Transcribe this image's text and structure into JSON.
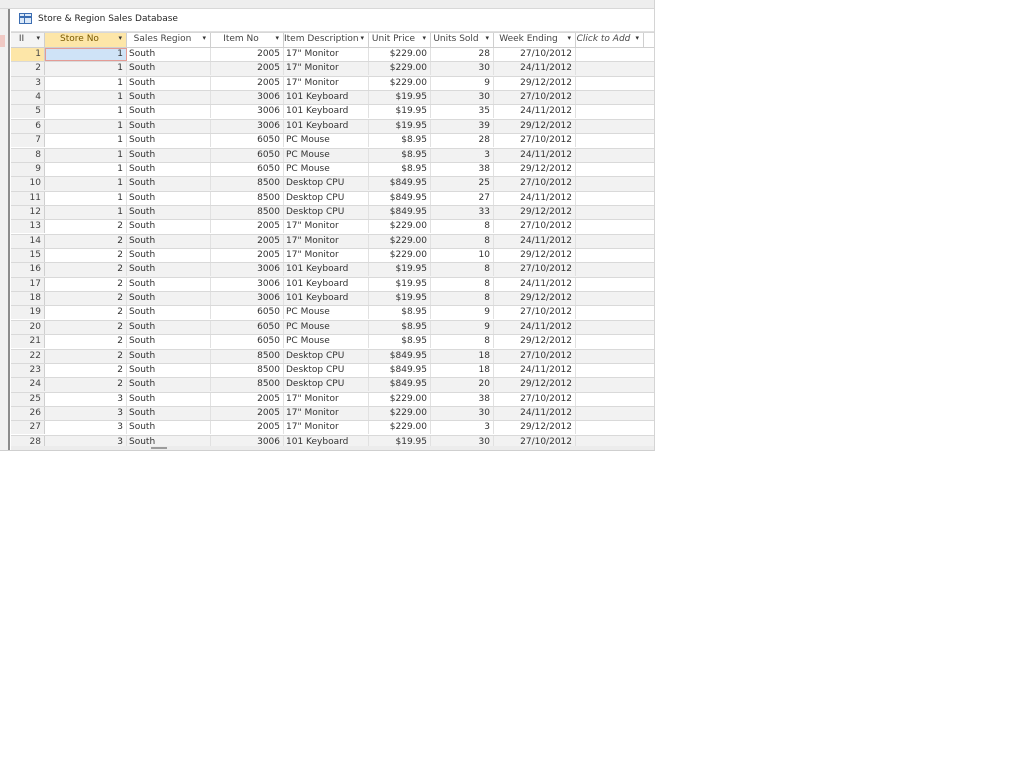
{
  "window": {
    "title": "Store & Region Sales Database",
    "icon": "datasheet-table-icon"
  },
  "columns": [
    {
      "key": "id",
      "label": "II",
      "dropdown": true
    },
    {
      "key": "store_no",
      "label": "Store No",
      "dropdown": true
    },
    {
      "key": "sales_region",
      "label": "Sales Region",
      "dropdown": true
    },
    {
      "key": "item_no",
      "label": "Item No",
      "dropdown": true
    },
    {
      "key": "item_description",
      "label": "Item Description",
      "dropdown": true
    },
    {
      "key": "unit_price",
      "label": "Unit Price",
      "dropdown": true
    },
    {
      "key": "units_sold",
      "label": "Units Sold",
      "dropdown": true
    },
    {
      "key": "week_ending",
      "label": "Week Ending",
      "dropdown": true
    },
    {
      "key": "click_to_add",
      "label": "Click to Add",
      "dropdown": true
    }
  ],
  "rows": [
    [
      "1",
      "1",
      "South",
      "2005",
      "17\" Monitor",
      "$229.00",
      "28",
      "27/10/2012"
    ],
    [
      "2",
      "1",
      "South",
      "2005",
      "17\" Monitor",
      "$229.00",
      "30",
      "24/11/2012"
    ],
    [
      "3",
      "1",
      "South",
      "2005",
      "17\" Monitor",
      "$229.00",
      "9",
      "29/12/2012"
    ],
    [
      "4",
      "1",
      "South",
      "3006",
      "101 Keyboard",
      "$19.95",
      "30",
      "27/10/2012"
    ],
    [
      "5",
      "1",
      "South",
      "3006",
      "101 Keyboard",
      "$19.95",
      "35",
      "24/11/2012"
    ],
    [
      "6",
      "1",
      "South",
      "3006",
      "101 Keyboard",
      "$19.95",
      "39",
      "29/12/2012"
    ],
    [
      "7",
      "1",
      "South",
      "6050",
      "PC Mouse",
      "$8.95",
      "28",
      "27/10/2012"
    ],
    [
      "8",
      "1",
      "South",
      "6050",
      "PC Mouse",
      "$8.95",
      "3",
      "24/11/2012"
    ],
    [
      "9",
      "1",
      "South",
      "6050",
      "PC Mouse",
      "$8.95",
      "38",
      "29/12/2012"
    ],
    [
      "10",
      "1",
      "South",
      "8500",
      "Desktop CPU",
      "$849.95",
      "25",
      "27/10/2012"
    ],
    [
      "11",
      "1",
      "South",
      "8500",
      "Desktop CPU",
      "$849.95",
      "27",
      "24/11/2012"
    ],
    [
      "12",
      "1",
      "South",
      "8500",
      "Desktop CPU",
      "$849.95",
      "33",
      "29/12/2012"
    ],
    [
      "13",
      "2",
      "South",
      "2005",
      "17\" Monitor",
      "$229.00",
      "8",
      "27/10/2012"
    ],
    [
      "14",
      "2",
      "South",
      "2005",
      "17\" Monitor",
      "$229.00",
      "8",
      "24/11/2012"
    ],
    [
      "15",
      "2",
      "South",
      "2005",
      "17\" Monitor",
      "$229.00",
      "10",
      "29/12/2012"
    ],
    [
      "16",
      "2",
      "South",
      "3006",
      "101 Keyboard",
      "$19.95",
      "8",
      "27/10/2012"
    ],
    [
      "17",
      "2",
      "South",
      "3006",
      "101 Keyboard",
      "$19.95",
      "8",
      "24/11/2012"
    ],
    [
      "18",
      "2",
      "South",
      "3006",
      "101 Keyboard",
      "$19.95",
      "8",
      "29/12/2012"
    ],
    [
      "19",
      "2",
      "South",
      "6050",
      "PC Mouse",
      "$8.95",
      "9",
      "27/10/2012"
    ],
    [
      "20",
      "2",
      "South",
      "6050",
      "PC Mouse",
      "$8.95",
      "9",
      "24/11/2012"
    ],
    [
      "21",
      "2",
      "South",
      "6050",
      "PC Mouse",
      "$8.95",
      "8",
      "29/12/2012"
    ],
    [
      "22",
      "2",
      "South",
      "8500",
      "Desktop CPU",
      "$849.95",
      "18",
      "27/10/2012"
    ],
    [
      "23",
      "2",
      "South",
      "8500",
      "Desktop CPU",
      "$849.95",
      "18",
      "24/11/2012"
    ],
    [
      "24",
      "2",
      "South",
      "8500",
      "Desktop CPU",
      "$849.95",
      "20",
      "29/12/2012"
    ],
    [
      "25",
      "3",
      "South",
      "2005",
      "17\" Monitor",
      "$229.00",
      "38",
      "27/10/2012"
    ],
    [
      "26",
      "3",
      "South",
      "2005",
      "17\" Monitor",
      "$229.00",
      "30",
      "24/11/2012"
    ],
    [
      "27",
      "3",
      "South",
      "2005",
      "17\" Monitor",
      "$229.00",
      "3",
      "29/12/2012"
    ],
    [
      "28",
      "3",
      "South",
      "3006",
      "101 Keyboard",
      "$19.95",
      "30",
      "27/10/2012"
    ]
  ],
  "current_row_index": 0,
  "colors": {
    "header_active": "#fde6a8",
    "selected_cell": "#cfe3f7",
    "alt_row": "#f2f2f2"
  }
}
